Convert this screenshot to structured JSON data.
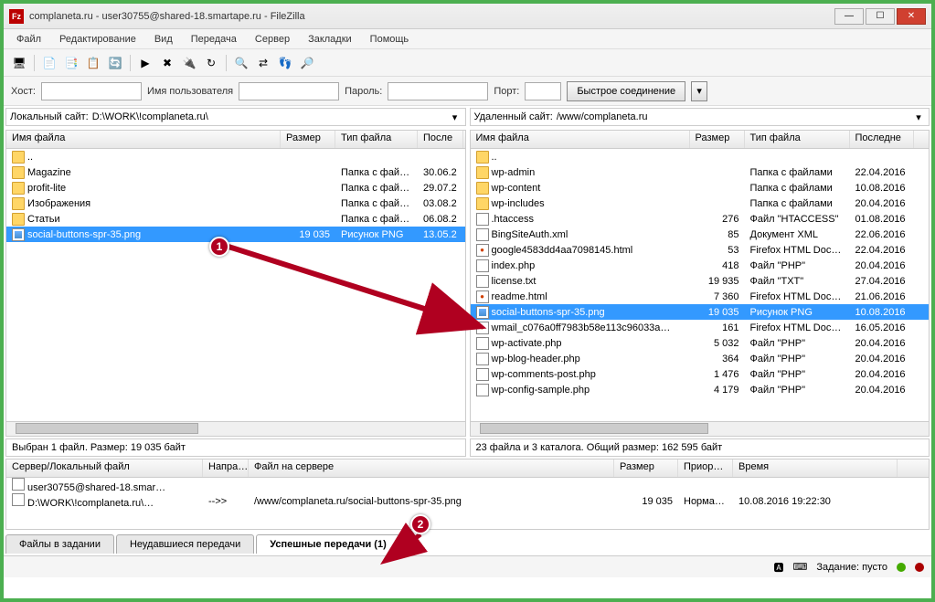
{
  "window": {
    "title": "complaneta.ru - user30755@shared-18.smartape.ru - FileZilla",
    "app_icon_text": "Fz"
  },
  "menu": [
    "Файл",
    "Редактирование",
    "Вид",
    "Передача",
    "Сервер",
    "Закладки",
    "Помощь"
  ],
  "quickconnect": {
    "host_label": "Хост:",
    "host_value": "",
    "user_label": "Имя пользователя",
    "user_value": "",
    "pass_label": "Пароль:",
    "pass_value": "",
    "port_label": "Порт:",
    "port_value": "",
    "connect_btn": "Быстрое соединение"
  },
  "local": {
    "label": "Локальный сайт:",
    "path": "D:\\WORK\\!complaneta.ru\\",
    "columns": [
      "Имя файла",
      "Размер",
      "Тип файла",
      "После"
    ],
    "rows": [
      {
        "icon": "folder",
        "name": "..",
        "size": "",
        "type": "",
        "date": ""
      },
      {
        "icon": "folder",
        "name": "Magazine",
        "size": "",
        "type": "Папка с файл…",
        "date": "30.06.2"
      },
      {
        "icon": "folder",
        "name": "profit-lite",
        "size": "",
        "type": "Папка с файл…",
        "date": "29.07.2"
      },
      {
        "icon": "folder",
        "name": "Изображения",
        "size": "",
        "type": "Папка с файл…",
        "date": "03.08.2"
      },
      {
        "icon": "folder",
        "name": "Статьи",
        "size": "",
        "type": "Папка с файл…",
        "date": "06.08.2"
      },
      {
        "icon": "img",
        "name": "social-buttons-spr-35.png",
        "size": "19 035",
        "type": "Рисунок PNG",
        "date": "13.05.2",
        "selected": true
      }
    ],
    "status": "Выбран 1 файл. Размер: 19 035 байт"
  },
  "remote": {
    "label": "Удаленный сайт:",
    "path": "/www/complaneta.ru",
    "columns": [
      "Имя файла",
      "Размер",
      "Тип файла",
      "Последне"
    ],
    "rows": [
      {
        "icon": "folder",
        "name": "..",
        "size": "",
        "type": "",
        "date": ""
      },
      {
        "icon": "folder",
        "name": "wp-admin",
        "size": "",
        "type": "Папка с файлами",
        "date": "22.04.2016"
      },
      {
        "icon": "folder",
        "name": "wp-content",
        "size": "",
        "type": "Папка с файлами",
        "date": "10.08.2016"
      },
      {
        "icon": "folder",
        "name": "wp-includes",
        "size": "",
        "type": "Папка с файлами",
        "date": "20.04.2016"
      },
      {
        "icon": "file",
        "name": ".htaccess",
        "size": "276",
        "type": "Файл \"HTACCESS\"",
        "date": "01.08.2016"
      },
      {
        "icon": "file",
        "name": "BingSiteAuth.xml",
        "size": "85",
        "type": "Документ XML",
        "date": "22.06.2016"
      },
      {
        "icon": "html",
        "name": "google4583dd4aa7098145.html",
        "size": "53",
        "type": "Firefox HTML Doc…",
        "date": "22.04.2016"
      },
      {
        "icon": "file",
        "name": "index.php",
        "size": "418",
        "type": "Файл \"PHP\"",
        "date": "20.04.2016"
      },
      {
        "icon": "file",
        "name": "license.txt",
        "size": "19 935",
        "type": "Файл \"TXT\"",
        "date": "27.04.2016"
      },
      {
        "icon": "html",
        "name": "readme.html",
        "size": "7 360",
        "type": "Firefox HTML Doc…",
        "date": "21.06.2016"
      },
      {
        "icon": "img",
        "name": "social-buttons-spr-35.png",
        "size": "19 035",
        "type": "Рисунок PNG",
        "date": "10.08.2016",
        "selected": true
      },
      {
        "icon": "html",
        "name": "wmail_c076a0ff7983b58e113c96033a…",
        "size": "161",
        "type": "Firefox HTML Doc…",
        "date": "16.05.2016"
      },
      {
        "icon": "file",
        "name": "wp-activate.php",
        "size": "5 032",
        "type": "Файл \"PHP\"",
        "date": "20.04.2016"
      },
      {
        "icon": "file",
        "name": "wp-blog-header.php",
        "size": "364",
        "type": "Файл \"PHP\"",
        "date": "20.04.2016"
      },
      {
        "icon": "file",
        "name": "wp-comments-post.php",
        "size": "1 476",
        "type": "Файл \"PHP\"",
        "date": "20.04.2016"
      },
      {
        "icon": "file",
        "name": "wp-config-sample.php",
        "size": "4 179",
        "type": "Файл \"PHP\"",
        "date": "20.04.2016"
      }
    ],
    "status": "23 файла и 3 каталога. Общий размер: 162 595 байт"
  },
  "queue": {
    "columns": [
      "Сервер/Локальный файл",
      "Напра…",
      "Файл на сервере",
      "Размер",
      "Приор…",
      "Время"
    ],
    "rows": [
      {
        "server": "user30755@shared-18.smar…",
        "dir": "",
        "remote": "",
        "size": "",
        "prio": "",
        "time": ""
      },
      {
        "server": "D:\\WORK\\!complaneta.ru\\…",
        "dir": "-->>",
        "remote": "/www/complaneta.ru/social-buttons-spr-35.png",
        "size": "19 035",
        "prio": "Норма…",
        "time": "10.08.2016 19:22:30"
      }
    ]
  },
  "tabs": {
    "items": [
      "Файлы в задании",
      "Неудавшиеся передачи",
      "Успешные передачи (1)"
    ],
    "active": 2
  },
  "bottombar": {
    "queue_label": "Задание: пусто"
  },
  "markers": {
    "m1": "1",
    "m2": "2"
  }
}
